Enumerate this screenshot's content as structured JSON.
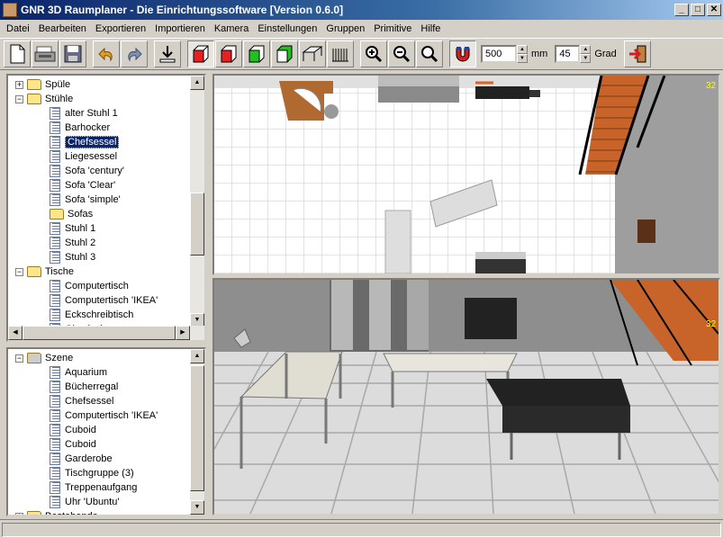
{
  "window": {
    "title": "GNR 3D Raumplaner - Die Einrichtungssoftware [Version 0.6.0]",
    "min_label": "_",
    "max_label": "□",
    "close_label": "✕"
  },
  "menu": [
    "Datei",
    "Bearbeiten",
    "Exportieren",
    "Importieren",
    "Kamera",
    "Einstellungen",
    "Gruppen",
    "Primitive",
    "Hilfe"
  ],
  "toolbar": {
    "buttons": [
      {
        "name": "new-icon"
      },
      {
        "name": "open-icon"
      },
      {
        "name": "save-icon"
      },
      {
        "name": "undo-icon"
      },
      {
        "name": "redo-icon"
      },
      {
        "name": "import-icon"
      },
      {
        "name": "cube-red-outline-icon"
      },
      {
        "name": "cube-red-icon"
      },
      {
        "name": "cube-green-icon"
      },
      {
        "name": "cube-white-icon"
      },
      {
        "name": "table-icon"
      },
      {
        "name": "radiator-icon"
      },
      {
        "name": "zoom-in-icon"
      },
      {
        "name": "zoom-out-icon"
      },
      {
        "name": "zoom-fit-icon"
      },
      {
        "name": "magnet-icon"
      },
      {
        "name": "exit-icon"
      }
    ],
    "grid_value": "500",
    "grid_unit": "mm",
    "angle_value": "45",
    "angle_unit": "Grad"
  },
  "catalog": {
    "items": [
      {
        "label": "Spüle",
        "type": "folder",
        "level": 0,
        "expander": "+"
      },
      {
        "label": "Stühle",
        "type": "folder-open",
        "level": 0,
        "expander": "−"
      },
      {
        "label": "alter Stuhl 1",
        "type": "item",
        "level": 1
      },
      {
        "label": "Barhocker",
        "type": "item",
        "level": 1
      },
      {
        "label": "Chefsessel",
        "type": "item",
        "level": 1,
        "selected": true
      },
      {
        "label": "Liegesessel",
        "type": "item",
        "level": 1
      },
      {
        "label": "Sofa 'century'",
        "type": "item",
        "level": 1
      },
      {
        "label": "Sofa 'Clear'",
        "type": "item",
        "level": 1
      },
      {
        "label": "Sofa 'simple'",
        "type": "item",
        "level": 1
      },
      {
        "label": "Sofas",
        "type": "folder",
        "level": 1
      },
      {
        "label": "Stuhl 1",
        "type": "item",
        "level": 1
      },
      {
        "label": "Stuhl 2",
        "type": "item",
        "level": 1
      },
      {
        "label": "Stuhl 3",
        "type": "item",
        "level": 1
      },
      {
        "label": "Tische",
        "type": "folder-open",
        "level": 0,
        "expander": "−"
      },
      {
        "label": "Computertisch",
        "type": "item",
        "level": 1
      },
      {
        "label": "Computertisch 'IKEA'",
        "type": "item",
        "level": 1
      },
      {
        "label": "Eckschreibtisch",
        "type": "item",
        "level": 1
      },
      {
        "label": "Glastisch",
        "type": "item",
        "level": 1
      }
    ]
  },
  "scene": {
    "items": [
      {
        "label": "Szene",
        "type": "scene",
        "level": 0,
        "expander": "−"
      },
      {
        "label": "Aquarium",
        "type": "item",
        "level": 1
      },
      {
        "label": "Bücherregal",
        "type": "item",
        "level": 1
      },
      {
        "label": "Chefsessel",
        "type": "item",
        "level": 1
      },
      {
        "label": "Computertisch 'IKEA'",
        "type": "item",
        "level": 1
      },
      {
        "label": "Cuboid",
        "type": "item",
        "level": 1
      },
      {
        "label": "Cuboid",
        "type": "item",
        "level": 1
      },
      {
        "label": "Garderobe",
        "type": "item",
        "level": 1
      },
      {
        "label": "Tischgruppe (3)",
        "type": "item",
        "level": 1
      },
      {
        "label": "Treppenaufgang",
        "type": "item",
        "level": 1
      },
      {
        "label": "Uhr 'Ubuntu'",
        "type": "item",
        "level": 1
      },
      {
        "label": "Bestehende...",
        "type": "folder",
        "level": 0,
        "expander": "+"
      }
    ]
  },
  "views": {
    "top_fps": "32",
    "persp_fps": "32"
  },
  "colors": {
    "title_start": "#0a246a",
    "title_end": "#a6caf0",
    "selection": "#0a246a",
    "stairs": "#c8642a",
    "fps": "#ffff00"
  }
}
